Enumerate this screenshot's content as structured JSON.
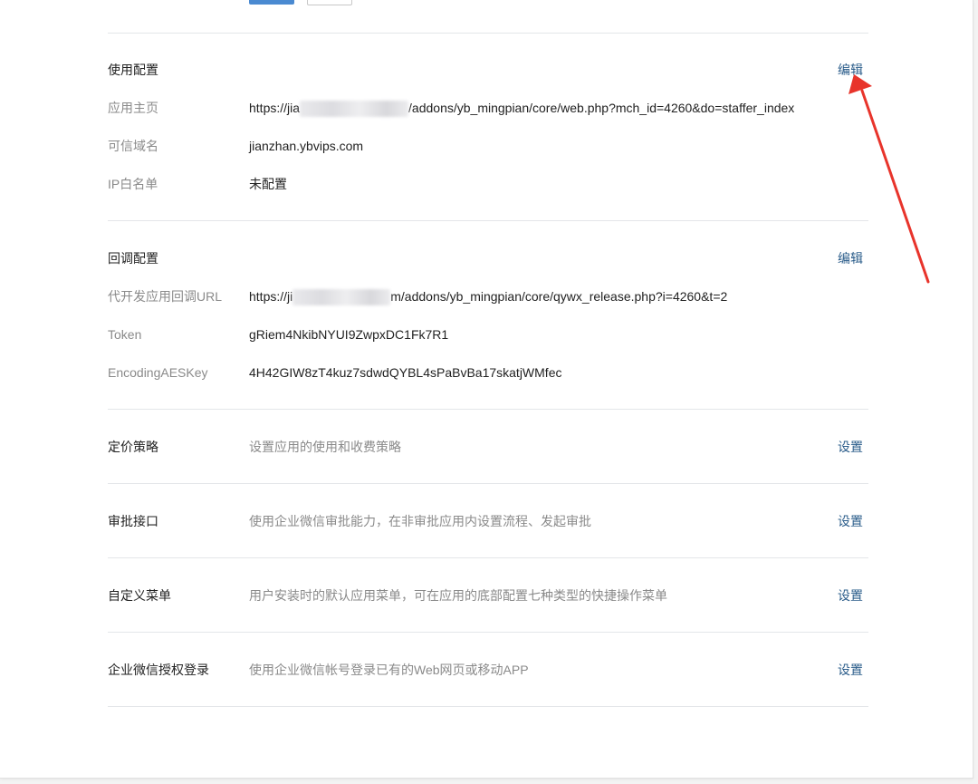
{
  "usage_config": {
    "title": "使用配置",
    "edit_label": "编辑",
    "rows": [
      {
        "label": "应用主页",
        "value_prefix": "https://jia",
        "value_suffix": "/addons/yb_mingpian/core/web.php?mch_id=4260&do=staffer_index"
      },
      {
        "label": "可信域名",
        "value": "jianzhan.ybvips.com"
      },
      {
        "label": "IP白名单",
        "value": "未配置"
      }
    ]
  },
  "callback_config": {
    "title": "回调配置",
    "edit_label": "编辑",
    "rows": [
      {
        "label": "代开发应用回调URL",
        "value_prefix": "https://ji",
        "value_suffix": "m/addons/yb_mingpian/core/qywx_release.php?i=4260&t=2"
      },
      {
        "label": "Token",
        "value": "gRiem4NkibNYUI9ZwpxDC1Fk7R1"
      },
      {
        "label": "EncodingAESKey",
        "value": "4H42GIW8zT4kuz7sdwdQYBL4sPaBvBa17skatjWMfec"
      }
    ]
  },
  "settings": [
    {
      "title": "定价策略",
      "desc": "设置应用的使用和收费策略",
      "action": "设置"
    },
    {
      "title": "审批接口",
      "desc": "使用企业微信审批能力，在非审批应用内设置流程、发起审批",
      "action": "设置"
    },
    {
      "title": "自定义菜单",
      "desc": "用户安装时的默认应用菜单，可在应用的底部配置七种类型的快捷操作菜单",
      "action": "设置"
    },
    {
      "title": "企业微信授权登录",
      "desc": "使用企业微信帐号登录已有的Web网页或移动APP",
      "action": "设置"
    }
  ],
  "colors": {
    "link": "#2a5c8a",
    "annotation_arrow": "#e8342b",
    "primary_button": "#4a8ad1"
  },
  "icons": {
    "annotation": "red-arrow-icon"
  }
}
